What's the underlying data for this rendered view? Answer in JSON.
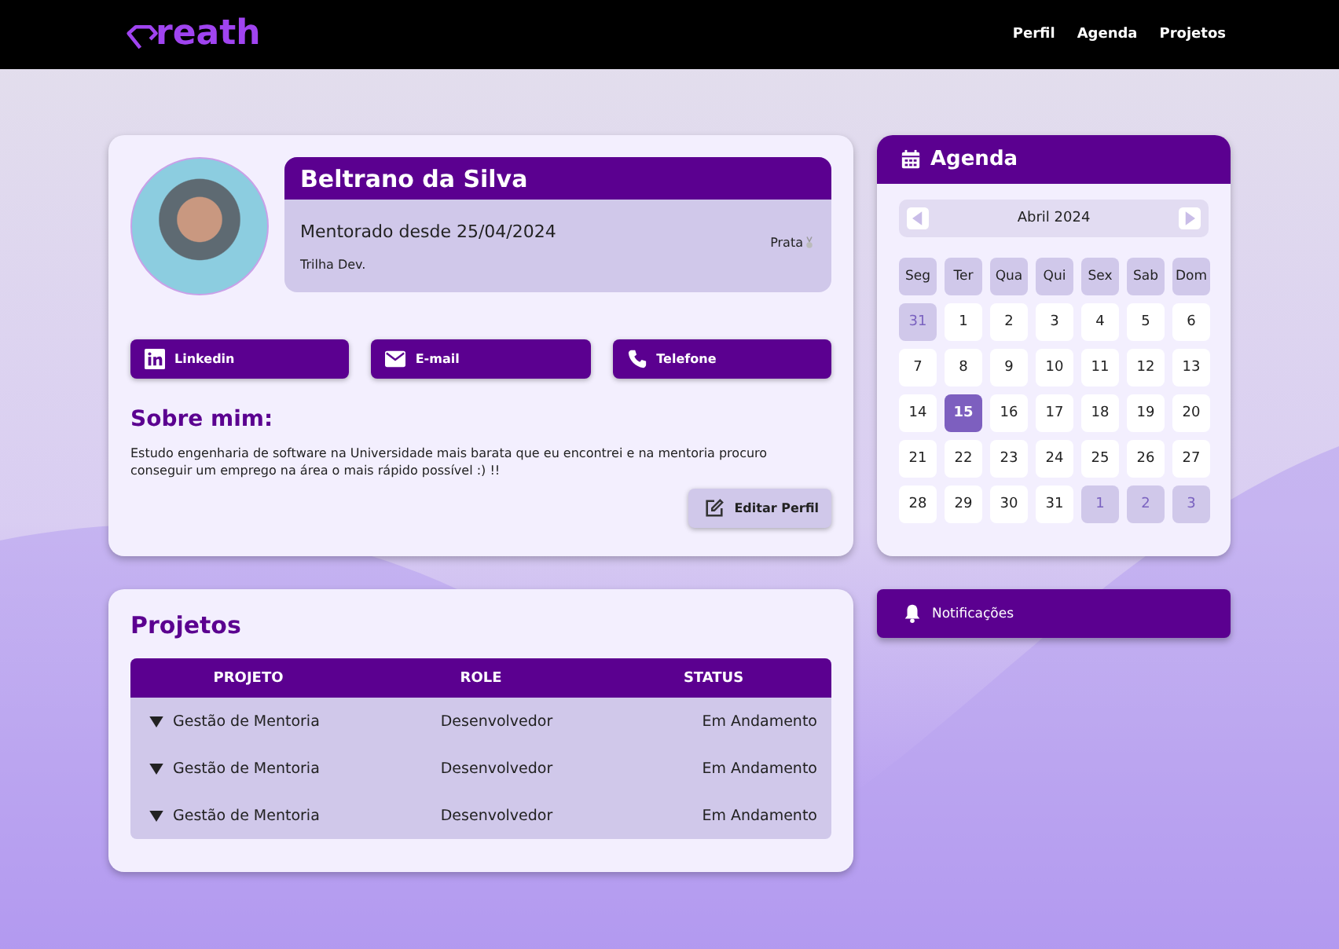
{
  "brand": {
    "name": "reath"
  },
  "nav": [
    "Perfil",
    "Agenda",
    "Projetos"
  ],
  "profile": {
    "name": "Beltrano da Silva",
    "since": "Mentorado desde 25/04/2024",
    "track": "Trilha Dev.",
    "tier": "Prata"
  },
  "contacts": [
    {
      "kind": "linkedin",
      "label": "Linkedin"
    },
    {
      "kind": "email",
      "label": "E-mail"
    },
    {
      "kind": "phone",
      "label": "Telefone"
    }
  ],
  "about": {
    "title": "Sobre mim:",
    "text": "Estudo engenharia de software na Universidade mais barata que eu encontrei e na mentoria procuro conseguir um emprego na área o mais rápido possível :) !!",
    "edit_button": "Editar Perfil"
  },
  "projects": {
    "title": "Projetos",
    "columns": [
      "PROJETO",
      "ROLE",
      "STATUS"
    ],
    "rows": [
      {
        "project": "Gestão de Mentoria",
        "role": "Desenvolvedor",
        "status": "Em Andamento"
      },
      {
        "project": "Gestão de Mentoria",
        "role": "Desenvolvedor",
        "status": "Em Andamento"
      },
      {
        "project": "Gestão de Mentoria",
        "role": "Desenvolvedor",
        "status": "Em Andamento"
      }
    ]
  },
  "agenda": {
    "title": "Agenda",
    "month": "Abril 2024",
    "weekdays": [
      "Seg",
      "Ter",
      "Qua",
      "Qui",
      "Sex",
      "Sab",
      "Dom"
    ],
    "days": [
      {
        "label": "31",
        "outside": true,
        "selected": false
      },
      {
        "label": "1",
        "outside": false,
        "selected": false
      },
      {
        "label": "2",
        "outside": false,
        "selected": false
      },
      {
        "label": "3",
        "outside": false,
        "selected": false
      },
      {
        "label": "4",
        "outside": false,
        "selected": false
      },
      {
        "label": "5",
        "outside": false,
        "selected": false
      },
      {
        "label": "6",
        "outside": false,
        "selected": false
      },
      {
        "label": "7",
        "outside": false,
        "selected": false
      },
      {
        "label": "8",
        "outside": false,
        "selected": false
      },
      {
        "label": "9",
        "outside": false,
        "selected": false
      },
      {
        "label": "10",
        "outside": false,
        "selected": false
      },
      {
        "label": "11",
        "outside": false,
        "selected": false
      },
      {
        "label": "12",
        "outside": false,
        "selected": false
      },
      {
        "label": "13",
        "outside": false,
        "selected": false
      },
      {
        "label": "14",
        "outside": false,
        "selected": false
      },
      {
        "label": "15",
        "outside": false,
        "selected": true
      },
      {
        "label": "16",
        "outside": false,
        "selected": false
      },
      {
        "label": "17",
        "outside": false,
        "selected": false
      },
      {
        "label": "18",
        "outside": false,
        "selected": false
      },
      {
        "label": "19",
        "outside": false,
        "selected": false
      },
      {
        "label": "20",
        "outside": false,
        "selected": false
      },
      {
        "label": "21",
        "outside": false,
        "selected": false
      },
      {
        "label": "22",
        "outside": false,
        "selected": false
      },
      {
        "label": "23",
        "outside": false,
        "selected": false
      },
      {
        "label": "24",
        "outside": false,
        "selected": false
      },
      {
        "label": "25",
        "outside": false,
        "selected": false
      },
      {
        "label": "26",
        "outside": false,
        "selected": false
      },
      {
        "label": "27",
        "outside": false,
        "selected": false
      },
      {
        "label": "28",
        "outside": false,
        "selected": false
      },
      {
        "label": "29",
        "outside": false,
        "selected": false
      },
      {
        "label": "30",
        "outside": false,
        "selected": false
      },
      {
        "label": "31",
        "outside": false,
        "selected": false
      },
      {
        "label": "1",
        "outside": true,
        "selected": false
      },
      {
        "label": "2",
        "outside": true,
        "selected": false
      },
      {
        "label": "3",
        "outside": true,
        "selected": false
      }
    ]
  },
  "notifications": {
    "label": "Notificações"
  }
}
